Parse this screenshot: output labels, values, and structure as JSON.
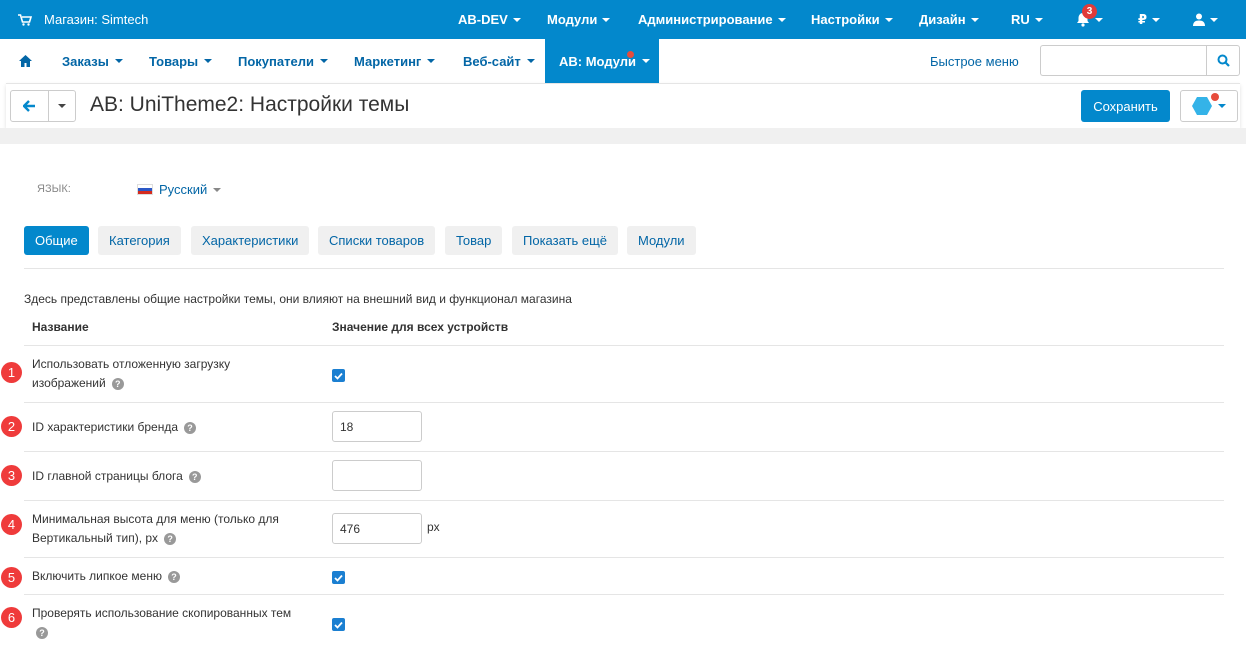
{
  "topbar": {
    "store": "Магазин: Simtech",
    "menu": [
      "AB-DEV",
      "Модули",
      "Администрирование",
      "Настройки",
      "Дизайн",
      "RU"
    ],
    "notifications_count": "3",
    "currency": "₽"
  },
  "nav": {
    "items": [
      "Заказы",
      "Товары",
      "Покупатели",
      "Маркетинг",
      "Веб-сайт"
    ],
    "active": "AB: Модули",
    "quick_menu": "Быстрое меню",
    "search_placeholder": ""
  },
  "title": {
    "prefix": "AB: UniTheme2",
    "suffix": ": Настройки темы",
    "save": "Сохранить"
  },
  "language": {
    "label": "ЯЗЫК:",
    "value": "Русский"
  },
  "tabs": [
    "Общие",
    "Категория",
    "Характеристики",
    "Списки товаров",
    "Товар",
    "Показать ещё",
    "Модули"
  ],
  "settings": {
    "intro": "Здесь представлены общие настройки темы, они влияют на внешний вид и функционал магазина",
    "col_name": "Название",
    "col_value": "Значение для всех устройств",
    "rows": [
      {
        "num": "1",
        "label_line1": "Использовать отложенную загрузку",
        "label_line2": "изображений",
        "type": "checkbox",
        "checked": true
      },
      {
        "num": "2",
        "label_line1": "ID характеристики бренда",
        "type": "input",
        "value": "18"
      },
      {
        "num": "3",
        "label_line1": "ID главной страницы блога",
        "type": "input",
        "value": ""
      },
      {
        "num": "4",
        "label_line1": "Минимальная высота для меню (только для",
        "label_line2": "Вертикальный тип), px",
        "type": "input",
        "value": "476",
        "unit": "px"
      },
      {
        "num": "5",
        "label_line1": "Включить липкое меню",
        "type": "checkbox",
        "checked": true
      },
      {
        "num": "6",
        "label_line1": "Проверять использование скопированных тем",
        "type": "checkbox",
        "checked": true
      }
    ]
  },
  "colors": {
    "primary": "#0388cc",
    "marker": "#ef3b3b"
  }
}
